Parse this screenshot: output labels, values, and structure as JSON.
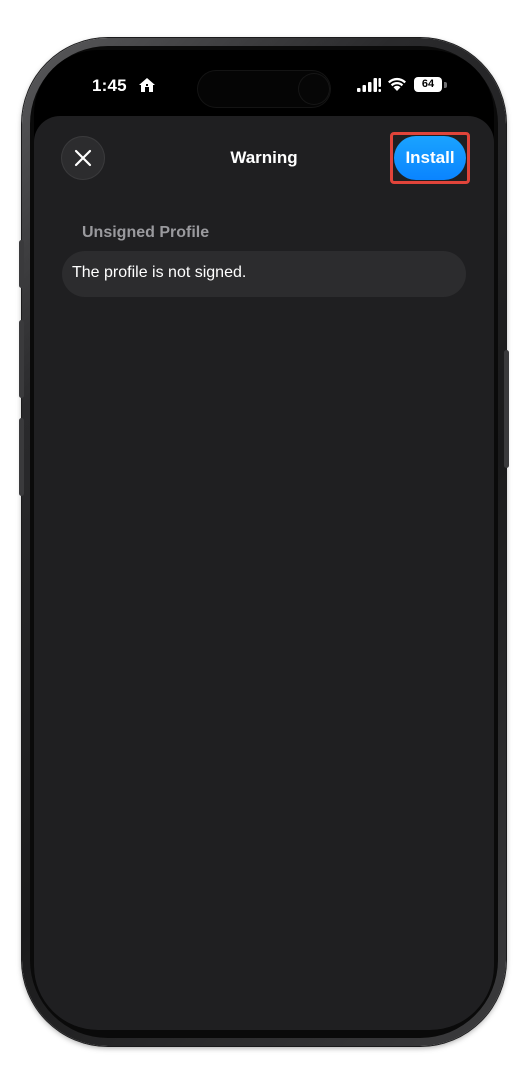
{
  "status_bar": {
    "time": "1:45",
    "battery_level": "64",
    "icons": [
      "home-icon",
      "signal-icon",
      "wifi-icon",
      "battery-icon"
    ]
  },
  "sheet": {
    "title": "Warning",
    "close_icon": "close-icon",
    "install_label": "Install"
  },
  "section": {
    "header": "Unsigned Profile",
    "rows": [
      {
        "text": "The profile is not signed."
      }
    ]
  },
  "colors": {
    "accent": "#0a84ff",
    "highlight": "#e0443a",
    "sheet_background": "#1f1f21",
    "row_background": "#2c2c2e",
    "secondary_text": "#9a9a9e"
  }
}
